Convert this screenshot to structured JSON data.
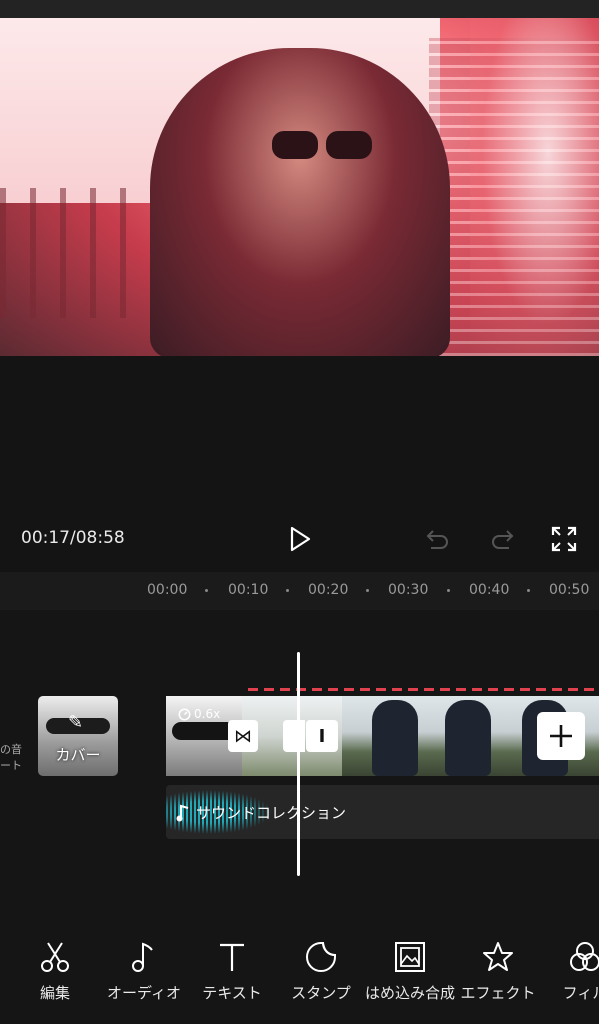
{
  "player": {
    "time_current": "00:17",
    "time_total": "08:58",
    "timecode": "00:17/08:58"
  },
  "ruler": {
    "ticks": [
      "00:00",
      "00:10",
      "00:20",
      "00:30",
      "00:40",
      "00:50"
    ]
  },
  "track": {
    "side_label_line1": "の音",
    "side_label_line2": "ート",
    "cover_label": "カバー",
    "speed_label": "0.6x",
    "audio_label": "サウンドコレクション"
  },
  "toolbar": {
    "items": [
      {
        "label": "編集",
        "icon": "scissors-icon"
      },
      {
        "label": "オーディオ",
        "icon": "music-note-icon"
      },
      {
        "label": "テキスト",
        "icon": "text-t-icon"
      },
      {
        "label": "スタンプ",
        "icon": "sticker-icon"
      },
      {
        "label": "はめ込み合成",
        "icon": "picture-in-picture-icon"
      },
      {
        "label": "エフェクト",
        "icon": "effect-star-icon"
      },
      {
        "label": "フィル",
        "icon": "filter-icon"
      }
    ]
  },
  "colors": {
    "background": "#141414",
    "accent_red": "#e0434f",
    "audio_wave": "#1fa9b8"
  }
}
